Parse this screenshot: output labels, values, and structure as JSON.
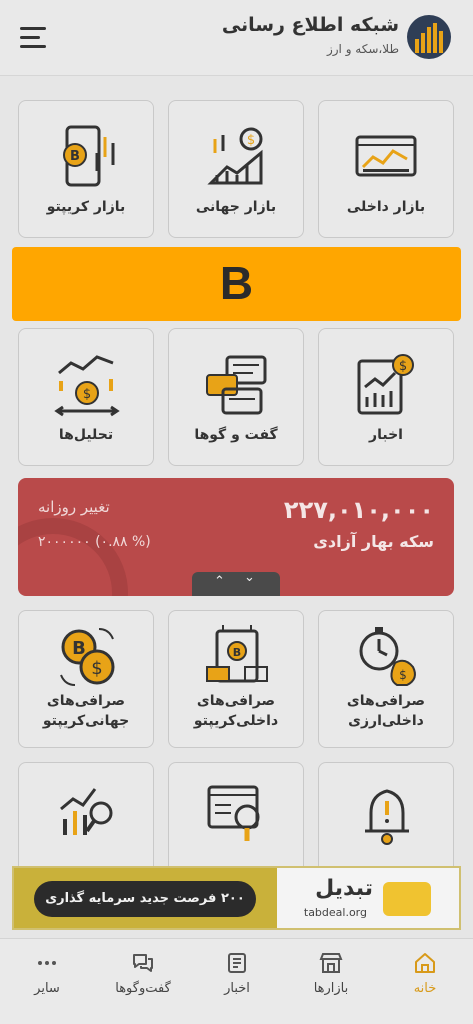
{
  "header": {
    "brand_title": "شبکه اطلاع رسانی",
    "brand_subtitle": "طلا،سکه و ارز"
  },
  "tiles_row1": [
    {
      "label": "بازار داخلی",
      "icon": "domestic-market-icon"
    },
    {
      "label": "بازار جهانی",
      "icon": "global-market-icon"
    },
    {
      "label": "بازار کریپتو",
      "icon": "crypto-market-icon"
    }
  ],
  "banner": {
    "text": "B",
    "color": "#ffa600"
  },
  "tiles_row2": [
    {
      "label": "اخبار",
      "icon": "news-icon"
    },
    {
      "label": "گفت و گوها",
      "icon": "chat-icon"
    },
    {
      "label": "تحلیل‌ها",
      "icon": "analysis-icon"
    }
  ],
  "price_card": {
    "value": "۲۲۷,۰۱۰,۰۰۰",
    "name": "سکه بهار آزادی",
    "change_title": "تغییر روزانه",
    "change_value": "۲۰۰۰۰۰۰ (۰.۸۸ %)",
    "up_arrow": "⌃",
    "down_arrow": "⌄",
    "color": "#b94a4a"
  },
  "tiles_row3": [
    {
      "label": "صرافی‌های داخلی‌ارزی",
      "icon": "currency-exchange-icon"
    },
    {
      "label": "صرافی‌های داخلی‌کریپتو",
      "icon": "crypto-exchange-domestic-icon"
    },
    {
      "label": "صرافی‌های جهانی‌کریپتو",
      "icon": "crypto-exchange-global-icon"
    }
  ],
  "tiles_row4": [
    {
      "label": "",
      "icon": "alert-bell-icon"
    },
    {
      "label": "",
      "icon": "web-search-icon"
    },
    {
      "label": "",
      "icon": "chart-search-icon"
    }
  ],
  "ad": {
    "slogan": "۲۰۰ فرصت جدید سرمایه گذاری",
    "brand": "تبدیل",
    "domain": "tabdeal.org"
  },
  "bottom_nav": [
    {
      "label": "خانه",
      "icon": "home-icon",
      "active": true
    },
    {
      "label": "بازارها",
      "icon": "store-icon",
      "active": false
    },
    {
      "label": "اخبار",
      "icon": "news-icon",
      "active": false
    },
    {
      "label": "گفت‌وگوها",
      "icon": "chat-icon",
      "active": false
    },
    {
      "label": "سایر",
      "icon": "more-icon",
      "active": false
    }
  ],
  "colors": {
    "accent": "#e8a317",
    "active_nav": "#d89a1a"
  }
}
